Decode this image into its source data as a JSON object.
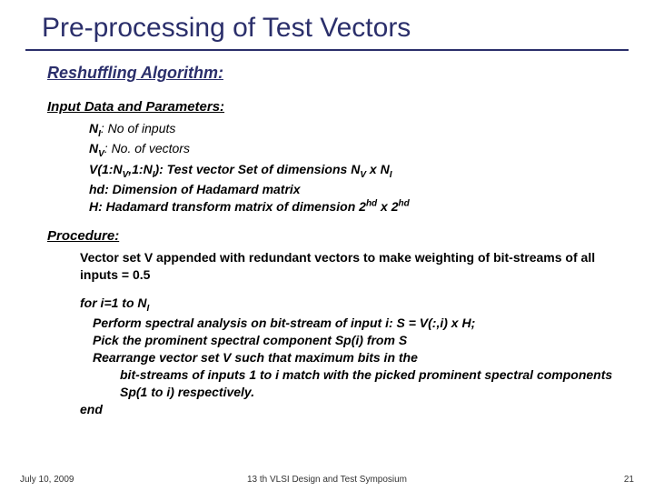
{
  "title": "Pre-processing of Test Vectors",
  "section1": "Reshuffling Algorithm:",
  "section2": "Input Data and Parameters:",
  "params": {
    "p1a": "N",
    "p1b": "I",
    "p1c": ": No of inputs",
    "p2a": "N",
    "p2b": "V",
    "p2c": ": No. of vectors",
    "p3a": "V(1:N",
    "p3b": "V",
    "p3c": ",1:N",
    "p3d": "I",
    "p3e": "): Test vector Set of dimensions N",
    "p3f": "V",
    "p3g": " x N",
    "p3h": "I",
    "p4": "hd: Dimension of Hadamard matrix",
    "p5a": "H: Hadamard transform matrix of dimension 2",
    "p5b": "hd",
    "p5c": " x 2",
    "p5d": "hd"
  },
  "section3": "Procedure:",
  "proc1": "Vector set V appended with redundant vectors to make weighting of bit-streams of all inputs = 0.5",
  "loop": {
    "for_a": "for i=1 to N",
    "for_b": "I",
    "l1": "Perform spectral analysis on bit-stream of input i: S = V(:,i) x H;",
    "l2": "Pick the prominent spectral component Sp(i) from S",
    "l3": "Rearrange vector set V such that maximum bits in the",
    "l4": "bit-streams of inputs 1 to i match with the picked prominent spectral components Sp(1 to i) respectively.",
    "end": "end"
  },
  "footer": {
    "left": "July 10, 2009",
    "center": "13 th VLSI Design and Test Symposium",
    "right": "21"
  }
}
